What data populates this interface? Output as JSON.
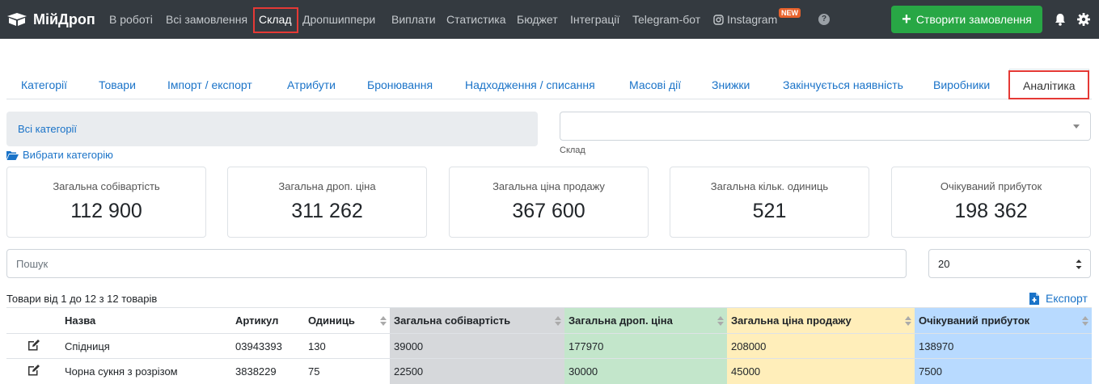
{
  "navbar": {
    "brand": "МійДроп",
    "items": [
      "В роботі",
      "Всі замовлення",
      "Склад",
      "Дропшиппери",
      "Виплати",
      "Статистика",
      "Бюджет",
      "Інтеграції",
      "Telegram-бот",
      "Instagram"
    ],
    "active": "Склад",
    "new_badge": "NEW",
    "help": "?",
    "create_order_label": "Створити замовлення"
  },
  "tabs": [
    "Категорії",
    "Товари",
    "Імпорт / експорт",
    "Атрибути",
    "Бронювання",
    "Надходження / списання",
    "Масові дії",
    "Знижки",
    "Закінчується наявність",
    "Виробники",
    "Аналітика"
  ],
  "active_tab": "Аналітика",
  "filters": {
    "all_categories": "Всі категорії",
    "choose_category": "Вибрати категорію",
    "warehouse_label": "Склад"
  },
  "stats": [
    {
      "label": "Загальна собівартість",
      "value": "112 900"
    },
    {
      "label": "Загальна дроп. ціна",
      "value": "311 262"
    },
    {
      "label": "Загальна ціна продажу",
      "value": "367 600"
    },
    {
      "label": "Загальна кільк. одиниць",
      "value": "521"
    },
    {
      "label": "Очікуваний прибуток",
      "value": "198 362"
    }
  ],
  "search": {
    "placeholder": "Пошук"
  },
  "page_size": "20",
  "info_text": "Товари від 1 до 12 з 12 товарів",
  "export_label": "Експорт",
  "table": {
    "headers": [
      "Назва",
      "Артикул",
      "Одиниць",
      "Загальна собівартість",
      "Загальна дроп. ціна",
      "Загальна ціна продажу",
      "Очікуваний прибуток"
    ],
    "rows": [
      [
        "Спідниця",
        "03943393",
        "130",
        "39000",
        "177970",
        "208000",
        "138970"
      ],
      [
        "Чорна сукня з розрізом",
        "3838229",
        "75",
        "22500",
        "30000",
        "45000",
        "7500"
      ]
    ]
  },
  "colors": {
    "navbar_bg": "#343a40",
    "accent_green": "#28a745",
    "link_blue": "#1a73c8",
    "highlight_red": "#e53935",
    "col_cost": "#d6d8db",
    "col_drop": "#c3e6cb",
    "col_sale": "#ffeeba",
    "col_profit": "#b8daff"
  }
}
